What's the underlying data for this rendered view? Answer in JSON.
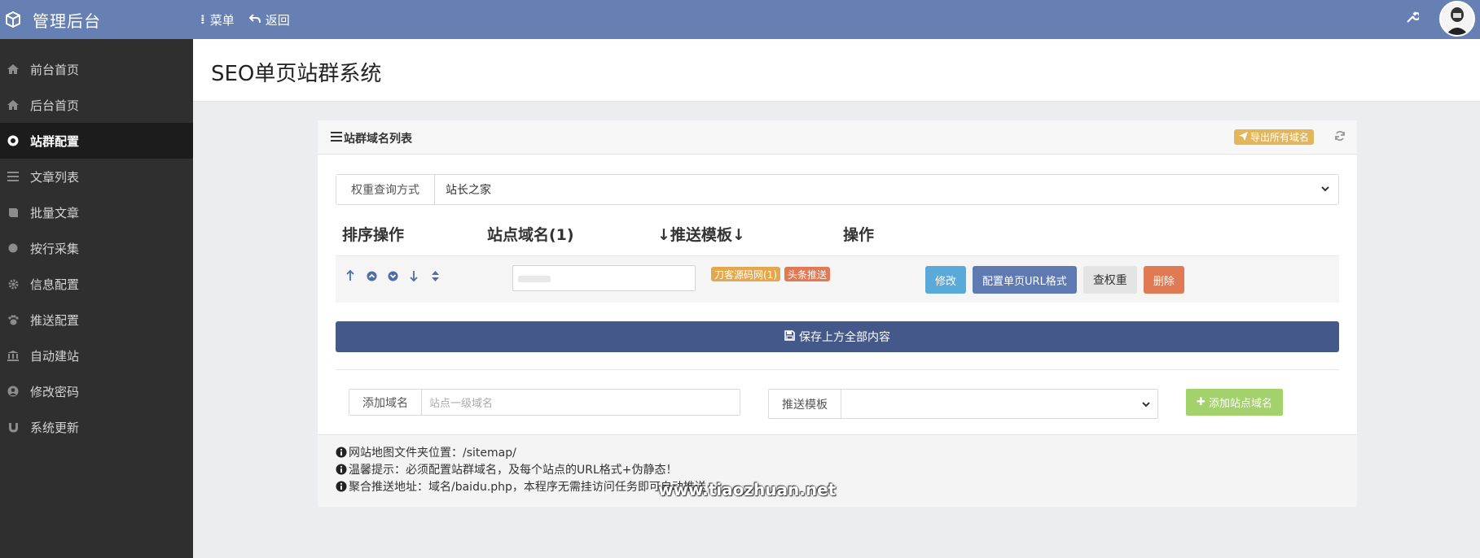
{
  "app": {
    "title": "管理后台",
    "menu_label": "菜单",
    "back_label": "返回"
  },
  "sidebar": {
    "items": [
      {
        "label": "前台首页",
        "icon": "home-icon"
      },
      {
        "label": "后台首页",
        "icon": "home-icon"
      },
      {
        "label": "站群配置",
        "icon": "chrome-icon"
      },
      {
        "label": "文章列表",
        "icon": "list-icon"
      },
      {
        "label": "批量文章",
        "icon": "book-icon"
      },
      {
        "label": "按行采集",
        "icon": "circle-icon"
      },
      {
        "label": "信息配置",
        "icon": "gear-icon"
      },
      {
        "label": "推送配置",
        "icon": "paw-icon"
      },
      {
        "label": "自动建站",
        "icon": "bank-icon"
      },
      {
        "label": "修改密码",
        "icon": "user-circle-icon"
      },
      {
        "label": "系统更新",
        "icon": "magnet-icon"
      }
    ],
    "active_index": 2
  },
  "page": {
    "title": "SEO单页站群系统"
  },
  "panel": {
    "title": "站群域名列表",
    "export_label": "导出所有域名",
    "query": {
      "label": "权重查询方式",
      "value": "站长之家"
    },
    "table": {
      "headers": [
        "排序操作",
        "站点域名(1)",
        "↓推送模板↓",
        "操作"
      ],
      "rows": [
        {
          "domain_value": "",
          "tags": [
            "刀客源码网(1)",
            "头条推送"
          ],
          "buttons": [
            "修改",
            "配置单页URL格式",
            "查权重",
            "删除"
          ]
        }
      ]
    },
    "save_label": "保存上方全部内容",
    "add_domain": {
      "label": "添加域名",
      "placeholder": "站点一级域名"
    },
    "push_template": {
      "label": "推送模板",
      "value": ""
    },
    "add_site_label": "添加站点域名",
    "tips": [
      "网站地图文件夹位置：/sitemap/",
      "温馨提示：必须配置站群域名，及每个站点的URL格式+伪静态！",
      "聚合推送地址：域名/baidu.php，本程序无需挂访问任务即可自动推送"
    ]
  },
  "watermark": "www.tiaozhuan.net",
  "colors": {
    "topbar": "#6680b3",
    "sidebar": "#2f2f2f",
    "save_button": "#44588a",
    "info_button": "#5aaad9",
    "primary_button": "#5f7ab2",
    "danger_button": "#e07a55",
    "add_site_button": "#a3d16b",
    "export_badge": "#e3b65b"
  }
}
